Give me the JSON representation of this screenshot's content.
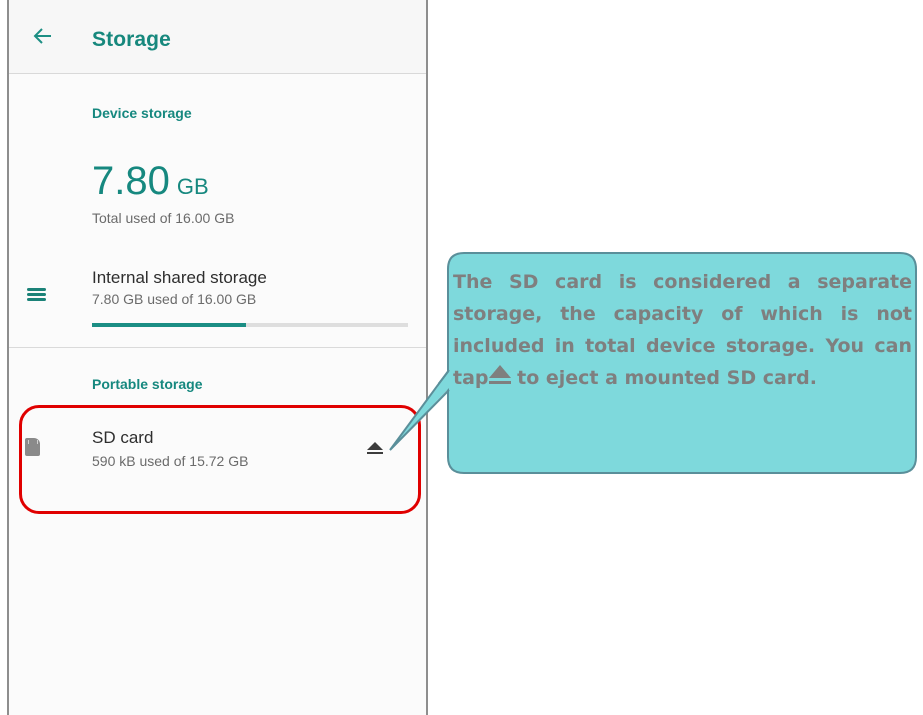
{
  "appbar": {
    "title": "Storage"
  },
  "device_storage": {
    "section_title": "Device storage",
    "total_value": "7.80",
    "total_unit": "GB",
    "total_caption": "Total used of 16.00 GB"
  },
  "internal": {
    "title": "Internal shared storage",
    "subtitle": "7.80 GB used of 16.00 GB",
    "used_fraction": 0.4875
  },
  "portable_storage": {
    "section_title": "Portable storage",
    "sd_card_title": "SD card",
    "sd_card_subtitle": "590 kB used of 15.72 GB"
  },
  "callout": {
    "text_before": "The SD card is considered a separate storage, the capacity of which is not included in total device storage. You can tap",
    "text_after": " to eject a mounted SD card."
  },
  "colors": {
    "accent": "#17887d",
    "highlight": "#e00000",
    "callout_fill": "#7ed9dc",
    "callout_text": "#7f7f7f"
  },
  "icons": [
    "back-arrow-icon",
    "storage-list-icon",
    "sd-card-icon",
    "eject-icon"
  ]
}
